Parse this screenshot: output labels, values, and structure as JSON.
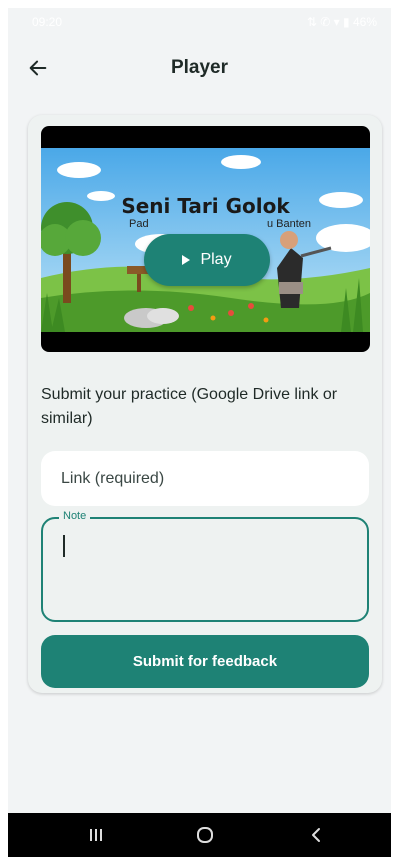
{
  "status_bar": {
    "time": "09:20",
    "icons_text": "⇅ ✆ ▾ ▮ 46%"
  },
  "app_bar": {
    "title": "Player",
    "back_icon": "arrow-left-icon"
  },
  "video": {
    "thumbnail_title": "Seni Tari Golok",
    "thumbnail_subtitle_start": "Pad",
    "thumbnail_subtitle_end": "u Banten",
    "play_label": "Play"
  },
  "form": {
    "prompt": "Submit your practice (Google Drive link or similar)",
    "link_placeholder": "Link (required)",
    "note_label": "Note",
    "note_value": "",
    "submit_label": "Submit for feedback"
  },
  "colors": {
    "accent": "#1e8275",
    "background": "#f2f4f5",
    "card": "#eef2f1"
  },
  "nav_bar": {
    "icons": [
      "recent-apps-icon",
      "home-icon",
      "back-icon"
    ]
  }
}
